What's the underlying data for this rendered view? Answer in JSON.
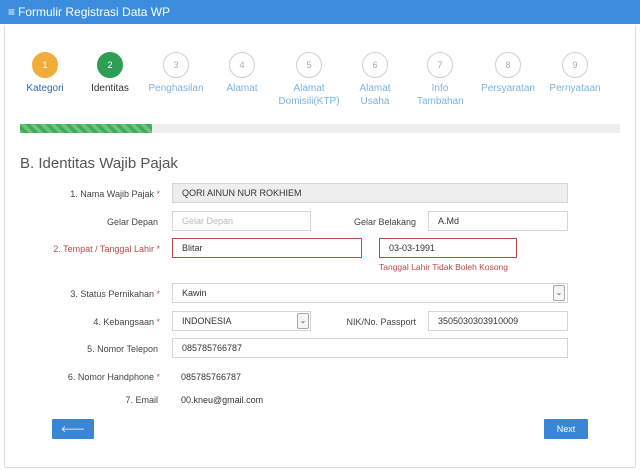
{
  "window": {
    "title": "Formulir Registrasi Data WP",
    "menu_icon": "≡"
  },
  "steps": [
    {
      "num": "1",
      "label": "Kategori",
      "state": "done"
    },
    {
      "num": "2",
      "label": "Identitas",
      "state": "active"
    },
    {
      "num": "3",
      "label": "Penghasilan",
      "state": "pending"
    },
    {
      "num": "4",
      "label": "Alamat",
      "state": "pending"
    },
    {
      "num": "5",
      "label": "Alamat Domisili(KTP)",
      "state": "pending"
    },
    {
      "num": "6",
      "label": "Alamat Usaha",
      "state": "pending"
    },
    {
      "num": "7",
      "label": "Info Tambahan",
      "state": "pending"
    },
    {
      "num": "8",
      "label": "Persyaratan",
      "state": "pending"
    },
    {
      "num": "9",
      "label": "Pernyataan",
      "state": "pending"
    }
  ],
  "progress": {
    "fraction": 0.22
  },
  "section": {
    "title": "B. Identitas Wajib Pajak"
  },
  "form": {
    "nama": {
      "label": "1. Nama Wajib Pajak",
      "value": "QORI AINUN NUR ROKHIEM"
    },
    "gelar_depan": {
      "label": "Gelar Depan",
      "placeholder": "Gelar Depan"
    },
    "gelar_belakang": {
      "label": "Gelar Belakang",
      "value": "A.Md"
    },
    "ttl": {
      "label": "2. Tempat / Tanggal Lahir",
      "tempat": "Blitar",
      "tanggal": "03-03-1991",
      "error": "Tanggal Lahir Tidak Boleh Kosong"
    },
    "status": {
      "label": "3. Status Pernikahan",
      "value": "Kawin"
    },
    "kebangsaan": {
      "label": "4. Kebangsaan",
      "value": "INDONESIA"
    },
    "nik": {
      "label": "NIK/No. Passport",
      "value": "3505030303910009"
    },
    "telepon": {
      "label": "5. Nomor Telepon",
      "value": "085785766787"
    },
    "handphone": {
      "label": "6. Nomor Handphone",
      "value": "085785766787"
    },
    "email": {
      "label": "7. Email",
      "value": "00.kneu@gmail.com"
    }
  },
  "required_mark": "*",
  "buttons": {
    "prev": "Prev",
    "next": "Next",
    "prev_icon": "🡐",
    "next_icon": "🡒"
  }
}
